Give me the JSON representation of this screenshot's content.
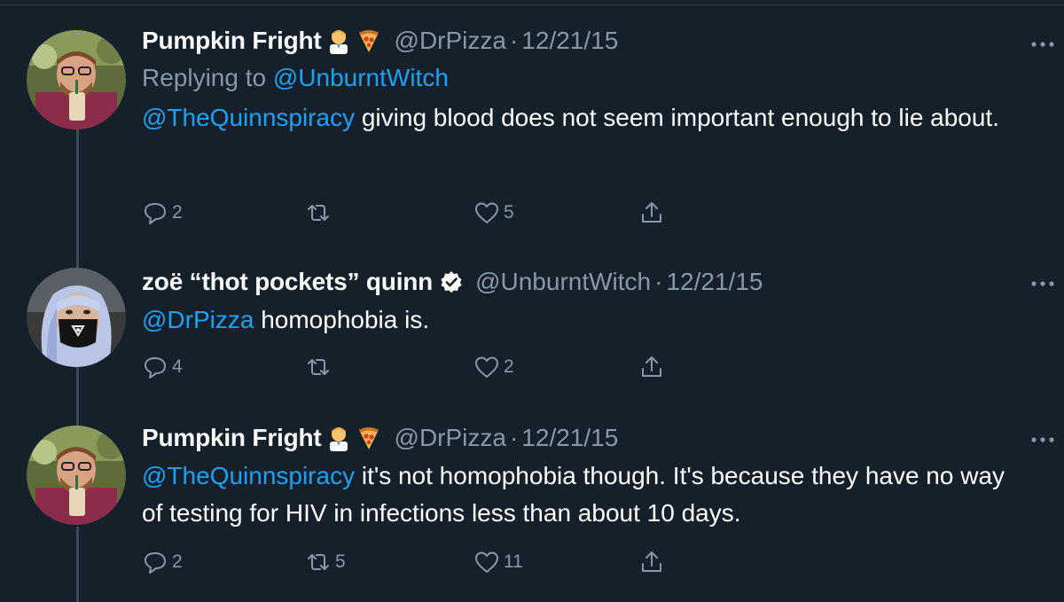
{
  "colors": {
    "background": "#15202b",
    "text": "#ffffff",
    "muted": "#8899a6",
    "link": "#1da1f2",
    "thread_line": "#3d4a57"
  },
  "tweets": [
    {
      "name": "Pumpkin Fright",
      "emojis": [
        "man-health-worker-emoji",
        "pizza-emoji"
      ],
      "verified": false,
      "handle": "@DrPizza",
      "separator": "·",
      "date": "12/21/15",
      "reply_prefix": "Replying to",
      "reply_to": "@UnburntWitch",
      "mention": "@TheQuinnspiracy",
      "text": " giving blood does not seem important enough to lie about.",
      "replies": "2",
      "retweets": "",
      "likes": "5"
    },
    {
      "name": "zoë “thot pockets” quinn",
      "emojis": [],
      "verified": true,
      "handle": "@UnburntWitch",
      "separator": "·",
      "date": "12/21/15",
      "mention": "@DrPizza",
      "text": " homophobia is.",
      "replies": "4",
      "retweets": "",
      "likes": "2"
    },
    {
      "name": "Pumpkin Fright",
      "emojis": [
        "man-health-worker-emoji",
        "pizza-emoji"
      ],
      "verified": false,
      "handle": "@DrPizza",
      "separator": "·",
      "date": "12/21/15",
      "mention": "@TheQuinnspiracy",
      "text": " it's not homophobia though. It's because they have no way of testing for HIV in infections less than about 10 days.",
      "replies": "2",
      "retweets": "5",
      "likes": "11"
    }
  ]
}
